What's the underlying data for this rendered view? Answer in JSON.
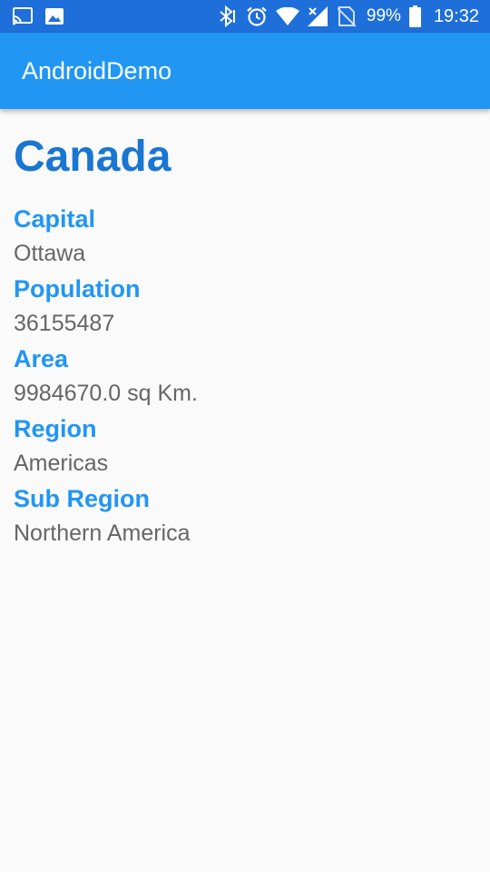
{
  "status_bar": {
    "left_icons": [
      "cast-icon",
      "image-icon"
    ],
    "right_icons": [
      "bluetooth-icon",
      "alarm-icon",
      "wifi-icon",
      "signal-icon",
      "no-sim-icon",
      "battery-icon"
    ],
    "battery_percent": "99%",
    "time": "19:32"
  },
  "app_bar": {
    "title": "AndroidDemo"
  },
  "country": {
    "name": "Canada",
    "fields": [
      {
        "label": "Capital",
        "value": "Ottawa"
      },
      {
        "label": "Population",
        "value": "36155487"
      },
      {
        "label": "Area",
        "value": "9984670.0 sq Km."
      },
      {
        "label": "Region",
        "value": "Americas"
      },
      {
        "label": "Sub Region",
        "value": "Northern America"
      }
    ]
  },
  "colors": {
    "status_bar": "#1e6fd9",
    "app_bar": "#2196f3",
    "title_text": "#1976d2",
    "label_text": "#2196f3",
    "value_text": "#666666",
    "background": "#fafafa"
  }
}
